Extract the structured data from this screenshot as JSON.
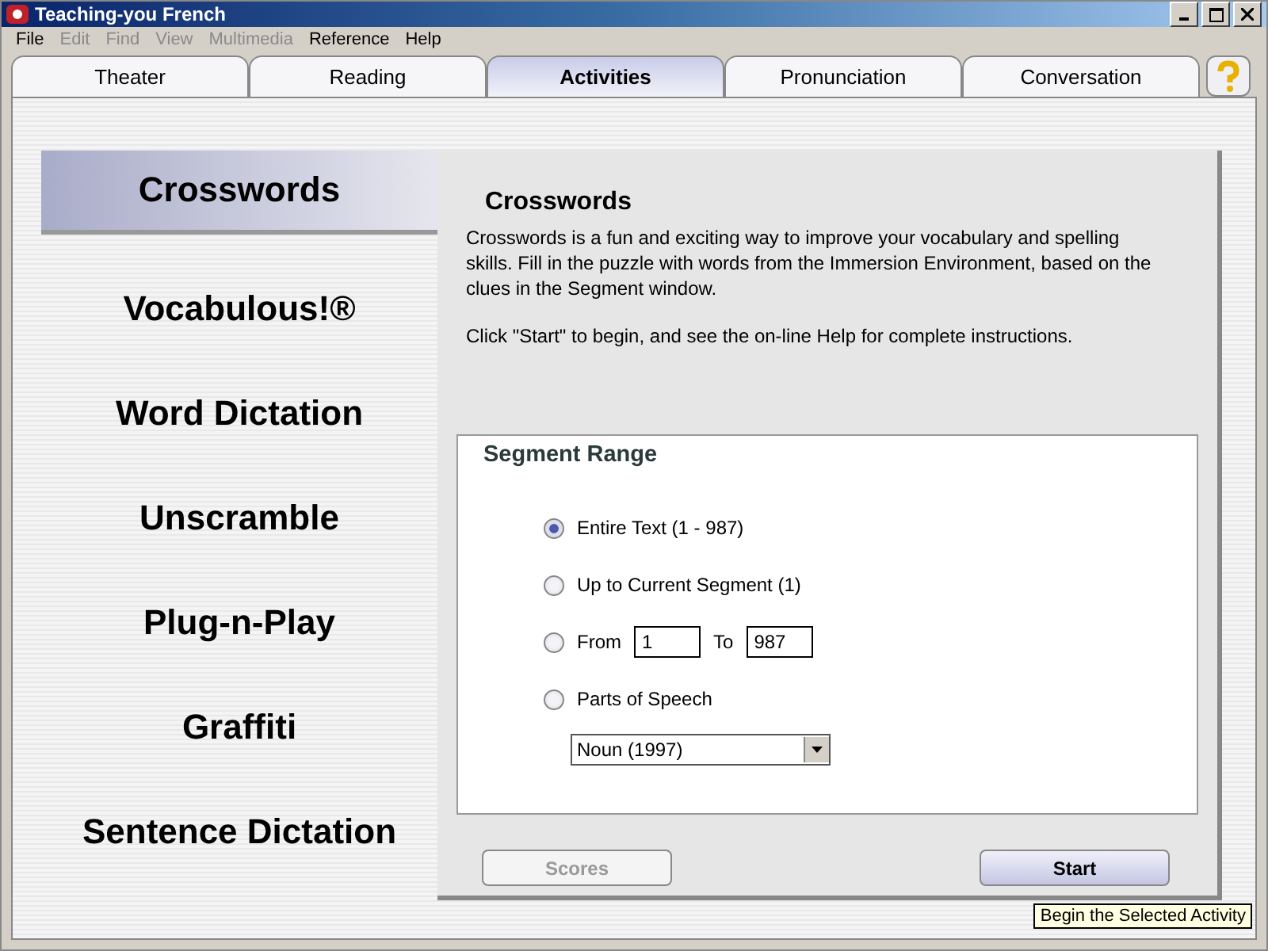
{
  "window": {
    "title": "Teaching-you French"
  },
  "menu": [
    {
      "label": "File",
      "disabled": false
    },
    {
      "label": "Edit",
      "disabled": true
    },
    {
      "label": "Find",
      "disabled": true
    },
    {
      "label": "View",
      "disabled": true
    },
    {
      "label": "Multimedia",
      "disabled": true
    },
    {
      "label": "Reference",
      "disabled": false
    },
    {
      "label": "Help",
      "disabled": false
    }
  ],
  "tabs": [
    {
      "label": "Theater",
      "selected": false
    },
    {
      "label": "Reading",
      "selected": false
    },
    {
      "label": "Activities",
      "selected": true
    },
    {
      "label": "Pronunciation",
      "selected": false
    },
    {
      "label": "Conversation",
      "selected": false
    }
  ],
  "activities": [
    {
      "label": "Crosswords",
      "selected": true
    },
    {
      "label": "Vocabulous!®",
      "selected": false
    },
    {
      "label": "Word Dictation",
      "selected": false
    },
    {
      "label": "Unscramble",
      "selected": false
    },
    {
      "label": "Plug-n-Play",
      "selected": false
    },
    {
      "label": "Graffiti",
      "selected": false
    },
    {
      "label": "Sentence Dictation",
      "selected": false
    }
  ],
  "description": {
    "title": "Crosswords",
    "paragraphs": [
      "Crosswords is a fun and exciting way to improve your vocabulary and spelling skills. Fill in the puzzle with words from the Immersion Environment, based on the clues in the Segment window.",
      "Click \"Start\" to begin, and see the on-line Help for complete instructions."
    ]
  },
  "segment_range": {
    "title": "Segment Range",
    "options": [
      {
        "kind": "plain",
        "label": "Entire Text (1 - 987)",
        "selected": true
      },
      {
        "kind": "plain",
        "label": "Up to Current Segment (1)",
        "selected": false
      },
      {
        "kind": "range",
        "label": "From",
        "to_label": "To",
        "from_value": "1",
        "to_value": "987",
        "selected": false
      },
      {
        "kind": "plain",
        "label": "Parts of Speech",
        "selected": false
      }
    ],
    "dropdown": {
      "value": "Noun (1997)"
    }
  },
  "buttons": [
    {
      "label": "Scores",
      "disabled": true
    },
    {
      "label": "Start",
      "disabled": false
    }
  ],
  "tooltip": "Begin the Selected Activity"
}
